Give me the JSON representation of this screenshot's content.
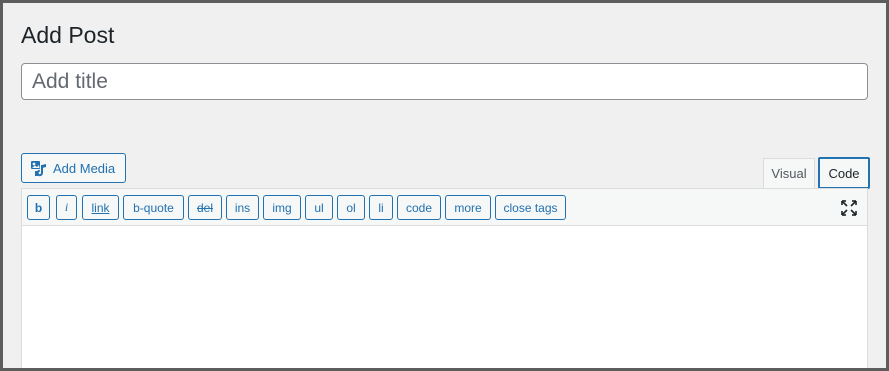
{
  "page": {
    "title": "Add Post"
  },
  "title_field": {
    "placeholder": "Add title",
    "value": ""
  },
  "media": {
    "add_media_label": "Add Media",
    "icon": "media-upload-icon"
  },
  "editor_tabs": [
    {
      "label": "Visual",
      "active": false
    },
    {
      "label": "Code",
      "active": true
    }
  ],
  "quicktags": [
    {
      "label": "b"
    },
    {
      "label": "i"
    },
    {
      "label": "link"
    },
    {
      "label": "b-quote"
    },
    {
      "label": "del"
    },
    {
      "label": "ins"
    },
    {
      "label": "img"
    },
    {
      "label": "ul"
    },
    {
      "label": "ol"
    },
    {
      "label": "li"
    },
    {
      "label": "code"
    },
    {
      "label": "more"
    },
    {
      "label": "close tags"
    }
  ],
  "toolbar": {
    "fullscreen_icon": "fullscreen-icon"
  },
  "content": {
    "value": ""
  },
  "colors": {
    "accent": "#2271b1",
    "background": "#f0f0f1",
    "text": "#1d2327"
  }
}
